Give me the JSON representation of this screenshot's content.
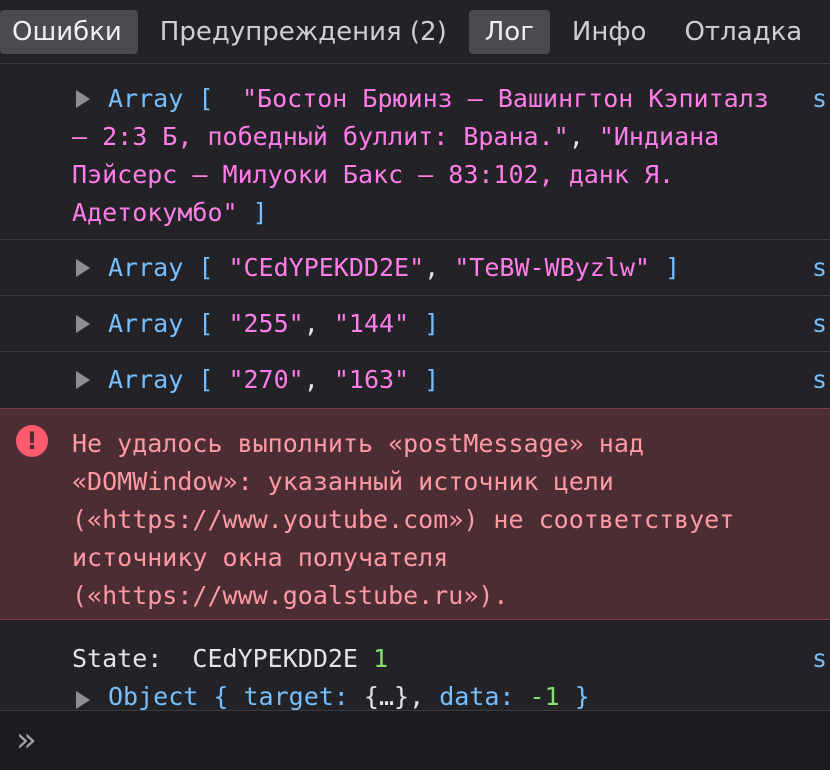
{
  "toolbar": {
    "tabs": [
      {
        "label": "Ошибки",
        "active": true
      },
      {
        "label": "Предупреждения (2)",
        "active": false
      },
      {
        "label": "Лог",
        "active": true
      },
      {
        "label": "Инфо",
        "active": false
      },
      {
        "label": "Отладка",
        "active": false
      }
    ]
  },
  "messages": {
    "m1": {
      "kw": "Array",
      "open": "[",
      "s1": "\"Бостон Брюинз – Вашингтон Кэпиталз — 2:3 Б, победный буллит: Врана.\"",
      "comma": ",",
      "s2": "\"Индиана Пэйсерс – Милуоки Бакс — 83:102, данк Я. Адетокумбо\"",
      "close": "]",
      "src": "s"
    },
    "m2": {
      "kw": "Array",
      "open": "[",
      "s1": "\"CEdYPEKDD2E\"",
      "comma": ",",
      "s2": "\"TeBW-WByzlw\"",
      "close": "]",
      "src": "s"
    },
    "m3": {
      "kw": "Array",
      "open": "[",
      "s1": "\"255\"",
      "comma": ",",
      "s2": "\"144\"",
      "close": "]",
      "src": "s"
    },
    "m4": {
      "kw": "Array",
      "open": "[",
      "s1": "\"270\"",
      "comma": ",",
      "s2": "\"163\"",
      "close": "]",
      "src": "s"
    },
    "error": {
      "icon": "!",
      "text": "Не удалось выполнить «postMessage» над «DOMWindow»: указанный источник цели («https://www.youtube.com») не соответствует источнику окна получателя («https://www.goalstube.ru»)."
    },
    "last": {
      "label": "State:",
      "value": "CEdYPEKDD2E",
      "num": "1",
      "obj_kw": "Object",
      "obj_open": "{",
      "target_key": "target:",
      "target_val": "{…},",
      "data_key": "data:",
      "data_val": "-1",
      "obj_close": "}",
      "src": "s"
    }
  },
  "prompt": {
    "symbol": "»"
  },
  "colors": {
    "background": "#232327",
    "keyword": "#75bfff",
    "string": "#ff7de9",
    "number": "#86de74",
    "error_bg": "#4b2d33",
    "error_text": "#ff9aa5"
  }
}
